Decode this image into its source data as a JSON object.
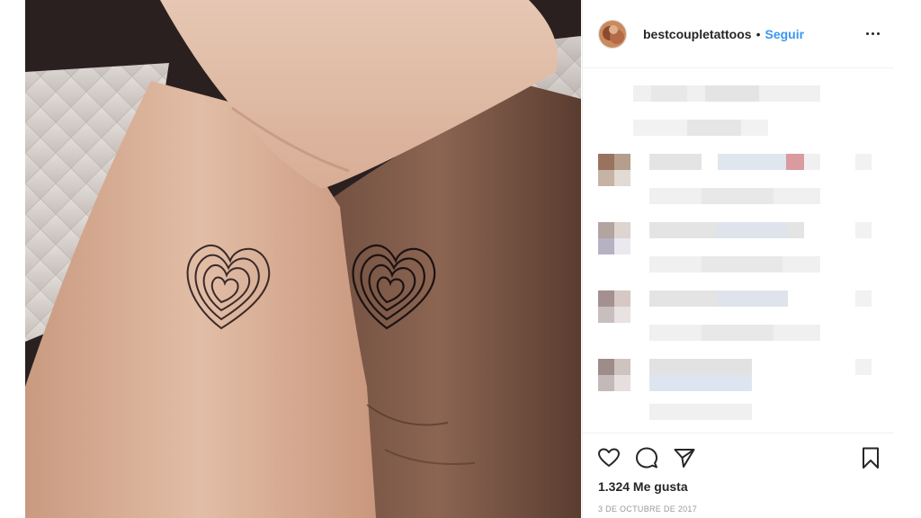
{
  "post": {
    "photo_alt": "Matching fingerprint heart tattoos on wrists",
    "author": {
      "username": "bestcoupletattoos",
      "separator": "•",
      "follow_label": "Seguir"
    },
    "likes_text": "1.324 Me gusta",
    "date_text": "3 DE OCTUBRE DE 2017",
    "comments_state": "blurred"
  },
  "icons": {
    "like": "heart-icon",
    "comment": "comment-icon",
    "share": "send-icon",
    "save": "bookmark-icon",
    "more": "more-options-icon"
  },
  "colors": {
    "link_blue": "#3897f0",
    "text": "#262626",
    "muted": "#999999",
    "divider": "#efefef"
  }
}
